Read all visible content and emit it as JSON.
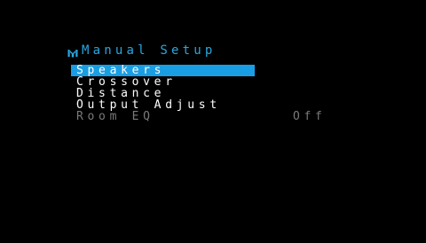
{
  "header": {
    "title": "Manual Setup",
    "icon": "speaker-setup-icon",
    "color": "#2aa7e0"
  },
  "menu": {
    "items": [
      {
        "label": "Speakers",
        "selected": true
      },
      {
        "label": "Crossover"
      },
      {
        "label": "Distance"
      },
      {
        "label": "Output Adjust"
      },
      {
        "label": "Room EQ",
        "value": "Off",
        "disabled": true
      }
    ]
  },
  "colors": {
    "background": "#000000",
    "highlight": "#1a9ee3",
    "text": "#ffffff",
    "disabled_text": "#7a7a7a"
  }
}
